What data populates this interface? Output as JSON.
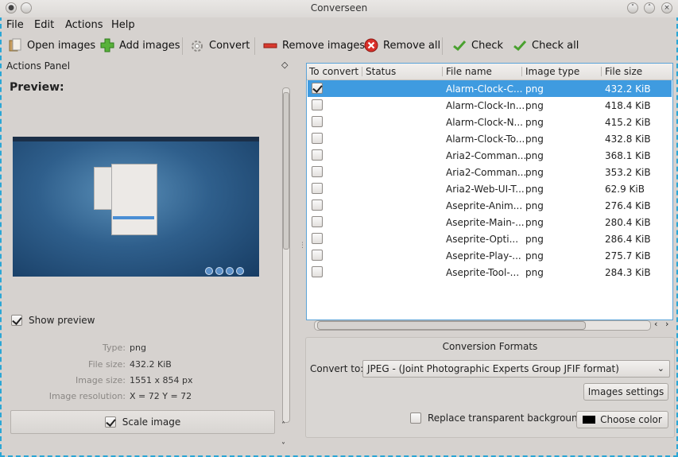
{
  "window": {
    "title": "Converseen"
  },
  "menu": [
    "File",
    "Edit",
    "Actions",
    "Help"
  ],
  "toolbar": {
    "open": "Open images",
    "add": "Add images",
    "convert": "Convert",
    "remove": "Remove images",
    "remove_all": "Remove all",
    "check": "Check",
    "check_all": "Check all"
  },
  "actions_panel": {
    "title": "Actions Panel",
    "preview_label": "Preview:",
    "show_preview_label": "Show preview",
    "show_preview_checked": true,
    "info": [
      {
        "label": "Type:",
        "value": "png"
      },
      {
        "label": "File size:",
        "value": "432.2 KiB"
      },
      {
        "label": "Image size:",
        "value": "1551 x 854 px"
      },
      {
        "label": "Image resolution:",
        "value": "X = 72 Y = 72"
      }
    ],
    "scale_image_label": "Scale image",
    "scale_image_checked": true
  },
  "table": {
    "columns": [
      "To convert",
      "Status",
      "File name",
      "Image type",
      "File size"
    ],
    "rows": [
      {
        "checked": true,
        "status": "",
        "file": "Alarm-Clock-C...",
        "type": "png",
        "size": "432.2 KiB",
        "selected": true
      },
      {
        "checked": false,
        "status": "",
        "file": "Alarm-Clock-In...",
        "type": "png",
        "size": "418.4 KiB"
      },
      {
        "checked": false,
        "status": "",
        "file": "Alarm-Clock-N...",
        "type": "png",
        "size": "415.2 KiB"
      },
      {
        "checked": false,
        "status": "",
        "file": "Alarm-Clock-To...",
        "type": "png",
        "size": "432.8 KiB"
      },
      {
        "checked": false,
        "status": "",
        "file": "Aria2-Comman...",
        "type": "png",
        "size": "368.1 KiB"
      },
      {
        "checked": false,
        "status": "",
        "file": "Aria2-Comman...",
        "type": "png",
        "size": "353.2 KiB"
      },
      {
        "checked": false,
        "status": "",
        "file": "Aria2-Web-UI-T...",
        "type": "png",
        "size": "62.9 KiB"
      },
      {
        "checked": false,
        "status": "",
        "file": "Aseprite-Anim...",
        "type": "png",
        "size": "276.4 KiB"
      },
      {
        "checked": false,
        "status": "",
        "file": "Aseprite-Main-...",
        "type": "png",
        "size": "280.4 KiB"
      },
      {
        "checked": false,
        "status": "",
        "file": "Aseprite-Opti...",
        "type": "png",
        "size": "286.4 KiB"
      },
      {
        "checked": false,
        "status": "",
        "file": "Aseprite-Play-...",
        "type": "png",
        "size": "275.7 KiB"
      },
      {
        "checked": false,
        "status": "",
        "file": "Aseprite-Tool-...",
        "type": "png",
        "size": "284.3 KiB"
      }
    ]
  },
  "conversion": {
    "title": "Conversion Formats",
    "convert_to_label": "Convert to:",
    "format": "JPEG - (Joint Photographic Experts Group JFIF format)",
    "images_settings": "Images settings",
    "replace_label": "Replace transparent background",
    "choose_color": "Choose color"
  },
  "colors": {
    "accent": "#3f9be0",
    "frame": "#2aa6d6"
  }
}
